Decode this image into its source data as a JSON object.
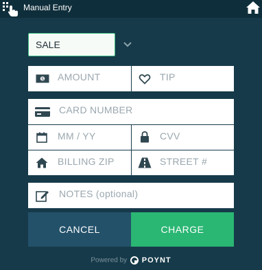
{
  "header": {
    "title": "Manual Entry",
    "app_icon": "touch-hand-grid-icon",
    "home_icon": "home-icon"
  },
  "form": {
    "transaction_type": "SALE",
    "amount_placeholder": "AMOUNT",
    "tip_placeholder": "TIP",
    "card_number_placeholder": "CARD NUMBER",
    "expiry_placeholder": "MM / YY",
    "cvv_placeholder": "CVV",
    "billing_zip_placeholder": "BILLING ZIP",
    "street_placeholder": "STREET #",
    "notes_placeholder": "NOTES  (optional)"
  },
  "actions": {
    "cancel_label": "CANCEL",
    "charge_label": "CHARGE"
  },
  "footer": {
    "powered_by": "Powered by",
    "brand": "POYNT"
  },
  "colors": {
    "background": "#143847",
    "header": "#0f2e3b",
    "cancel": "#23516a",
    "charge": "#2ab673",
    "select_border": "#3fbf86"
  }
}
